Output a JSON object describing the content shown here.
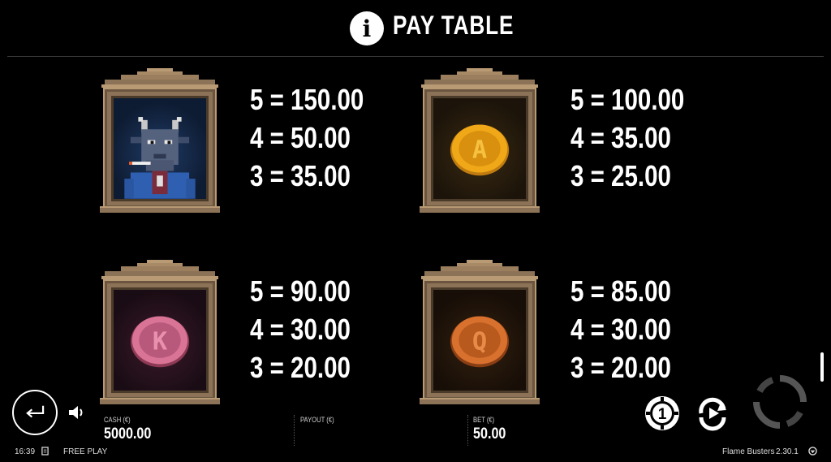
{
  "header": {
    "info_icon": "info-icon",
    "title": "PAY TABLE"
  },
  "symbols": [
    {
      "name": "goat",
      "pays": [
        "5 = 150.00",
        "4 = 50.00",
        "3 = 35.00"
      ],
      "bg_color": "#1f3a64"
    },
    {
      "name": "a-coin",
      "letter": "A",
      "pays": [
        "5 = 100.00",
        "4 = 35.00",
        "3 = 25.00"
      ],
      "color": "#e8a317"
    },
    {
      "name": "k-coin",
      "letter": "K",
      "pays": [
        "5 = 90.00",
        "4 = 30.00",
        "3 = 20.00"
      ],
      "color": "#c9607e"
    },
    {
      "name": "q-coin",
      "letter": "Q",
      "pays": [
        "5 = 85.00",
        "4 = 30.00",
        "3 = 20.00"
      ],
      "color": "#c8622a"
    }
  ],
  "footer": {
    "cash_label": "CASH (€)",
    "cash_value": "5000.00",
    "payout_label": "PAYOUT (€)",
    "payout_value": "",
    "bet_label": "BET (€)",
    "bet_value": "50.00"
  },
  "statusbar": {
    "time": "16:39",
    "mode": "FREE PLAY",
    "game_name": "Flame Busters",
    "version": "2.30.1"
  },
  "icons": [
    "back-arrow-icon",
    "speaker-icon",
    "coin-1-icon",
    "autoplay-icon",
    "spin-icon",
    "document-icon",
    "brand-logo-icon"
  ]
}
